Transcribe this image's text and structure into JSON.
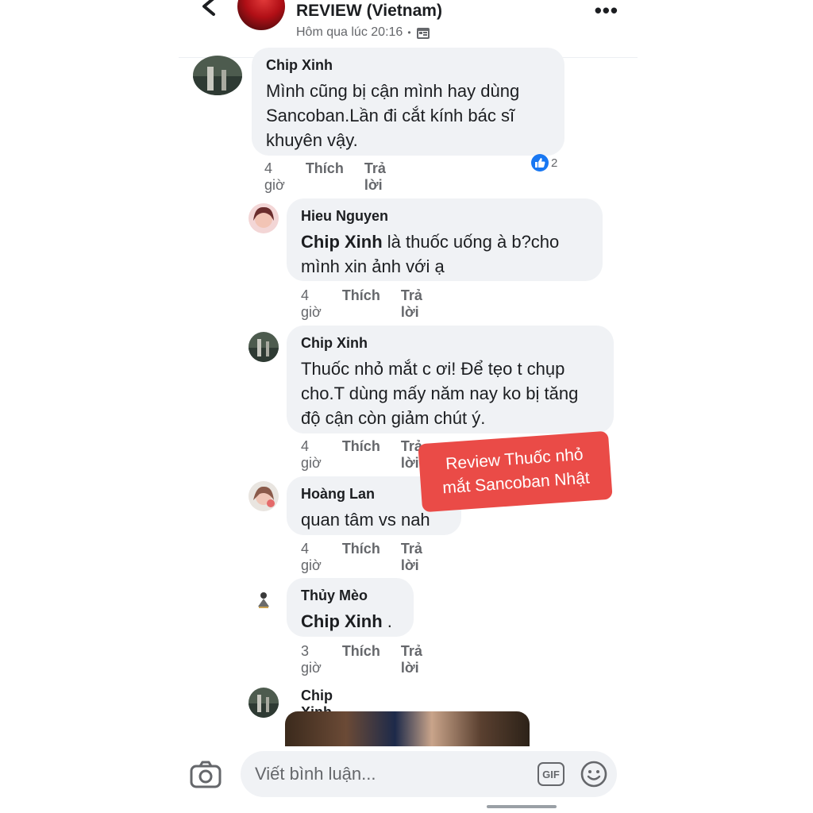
{
  "header": {
    "page_name": "REVIEW (Vietnam)",
    "timestamp": "Hôm qua lúc 20:16",
    "separator": "•"
  },
  "comments": [
    {
      "author": "Chip Xinh",
      "text": "Mình cũng bị cận mình hay dùng Sancoban.Lần đi cắt kính bác sĩ khuyên vậy.",
      "time": "4 giờ",
      "like_label": "Thích",
      "reply_label": "Trả lời",
      "reaction_count": "2"
    },
    {
      "author": "Hieu Nguyen",
      "mention": "Chip Xinh",
      "text": " là thuốc uống à b?cho mình xin ảnh với ạ",
      "time": "4 giờ",
      "like_label": "Thích",
      "reply_label": "Trả lời"
    },
    {
      "author": "Chip Xinh",
      "text": "Thuốc nhỏ mắt c ơi! Để tẹo t chụp cho.T dùng mấy năm nay ko bị tăng độ cận còn giảm chút ý.",
      "time": "4 giờ",
      "like_label": "Thích",
      "reply_label": "Trả lời"
    },
    {
      "author": "Hoàng Lan",
      "text": "quan tâm vs nah",
      "time": "4 giờ",
      "like_label": "Thích",
      "reply_label": "Trả lời"
    },
    {
      "author": "Thủy Mèo",
      "mention": "Chip Xinh",
      "text": " .",
      "time": "3 giờ",
      "like_label": "Thích",
      "reply_label": "Trả lời"
    },
    {
      "author": "Chip Xinh"
    }
  ],
  "composer": {
    "placeholder": "Viết bình luận...",
    "gif_label": "GIF"
  },
  "overlay": {
    "line1": "Review Thuốc nhỏ",
    "line2": "mắt Sancoban Nhật"
  },
  "colors": {
    "accent": "#1877f2",
    "promo": "#ea4b47",
    "bubble": "#f0f2f5"
  }
}
